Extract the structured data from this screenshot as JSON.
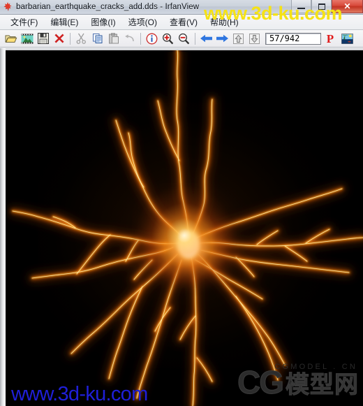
{
  "window": {
    "title": "barbarian_earthquake_cracks_add.dds - IrfanView",
    "icon": "irfanview-leaf-icon",
    "minimize_label": "",
    "maximize_label": "",
    "close_label": "✕"
  },
  "menubar": {
    "items": [
      {
        "label": "文件(F)",
        "name": "menu-file"
      },
      {
        "label": "编辑(E)",
        "name": "menu-edit"
      },
      {
        "label": "图像(I)",
        "name": "menu-image"
      },
      {
        "label": "选项(O)",
        "name": "menu-options"
      },
      {
        "label": "查看(V)",
        "name": "menu-view"
      },
      {
        "label": "帮助(H)",
        "name": "menu-help"
      }
    ]
  },
  "toolbar": {
    "buttons": [
      {
        "name": "open-folder-icon",
        "tooltip": "打开"
      },
      {
        "name": "thumbnails-icon",
        "tooltip": "缩略图"
      },
      {
        "name": "save-icon",
        "tooltip": "保存"
      },
      {
        "name": "delete-icon",
        "tooltip": "删除"
      },
      {
        "name": "cut-icon",
        "tooltip": "剪切"
      },
      {
        "name": "copy-icon",
        "tooltip": "复制"
      },
      {
        "name": "paste-icon",
        "tooltip": "粘贴"
      },
      {
        "name": "undo-icon",
        "tooltip": "撤销"
      },
      {
        "name": "info-icon",
        "tooltip": "信息"
      },
      {
        "name": "zoom-in-icon",
        "tooltip": "放大"
      },
      {
        "name": "zoom-out-icon",
        "tooltip": "缩小"
      },
      {
        "name": "previous-icon",
        "tooltip": "上一张"
      },
      {
        "name": "next-icon",
        "tooltip": "下一张"
      },
      {
        "name": "first-icon",
        "tooltip": "第一张"
      },
      {
        "name": "last-icon",
        "tooltip": "最后一张"
      },
      {
        "name": "print-icon",
        "tooltip": "打印"
      },
      {
        "name": "slideshow-icon",
        "tooltip": "幻灯片"
      }
    ],
    "counter_value": "57/942",
    "print_letter": "P"
  },
  "image": {
    "background_color": "#000000",
    "crack_color_hot": "#fff4c8",
    "crack_color_core": "#ffb020",
    "crack_color_edge": "#c24a05",
    "description": "barbarian earthquake cracks additive texture"
  },
  "watermarks": {
    "top_yellow": "www.3d-ku.com",
    "top_yellow_color": "#f5e215",
    "bottom_blue": "www.3d-ku.com",
    "bottom_blue_color": "#1f1fd8",
    "cg_tagline": "CGMODEL . CN",
    "cg_mark": "CG",
    "cg_cn": "模型网"
  }
}
